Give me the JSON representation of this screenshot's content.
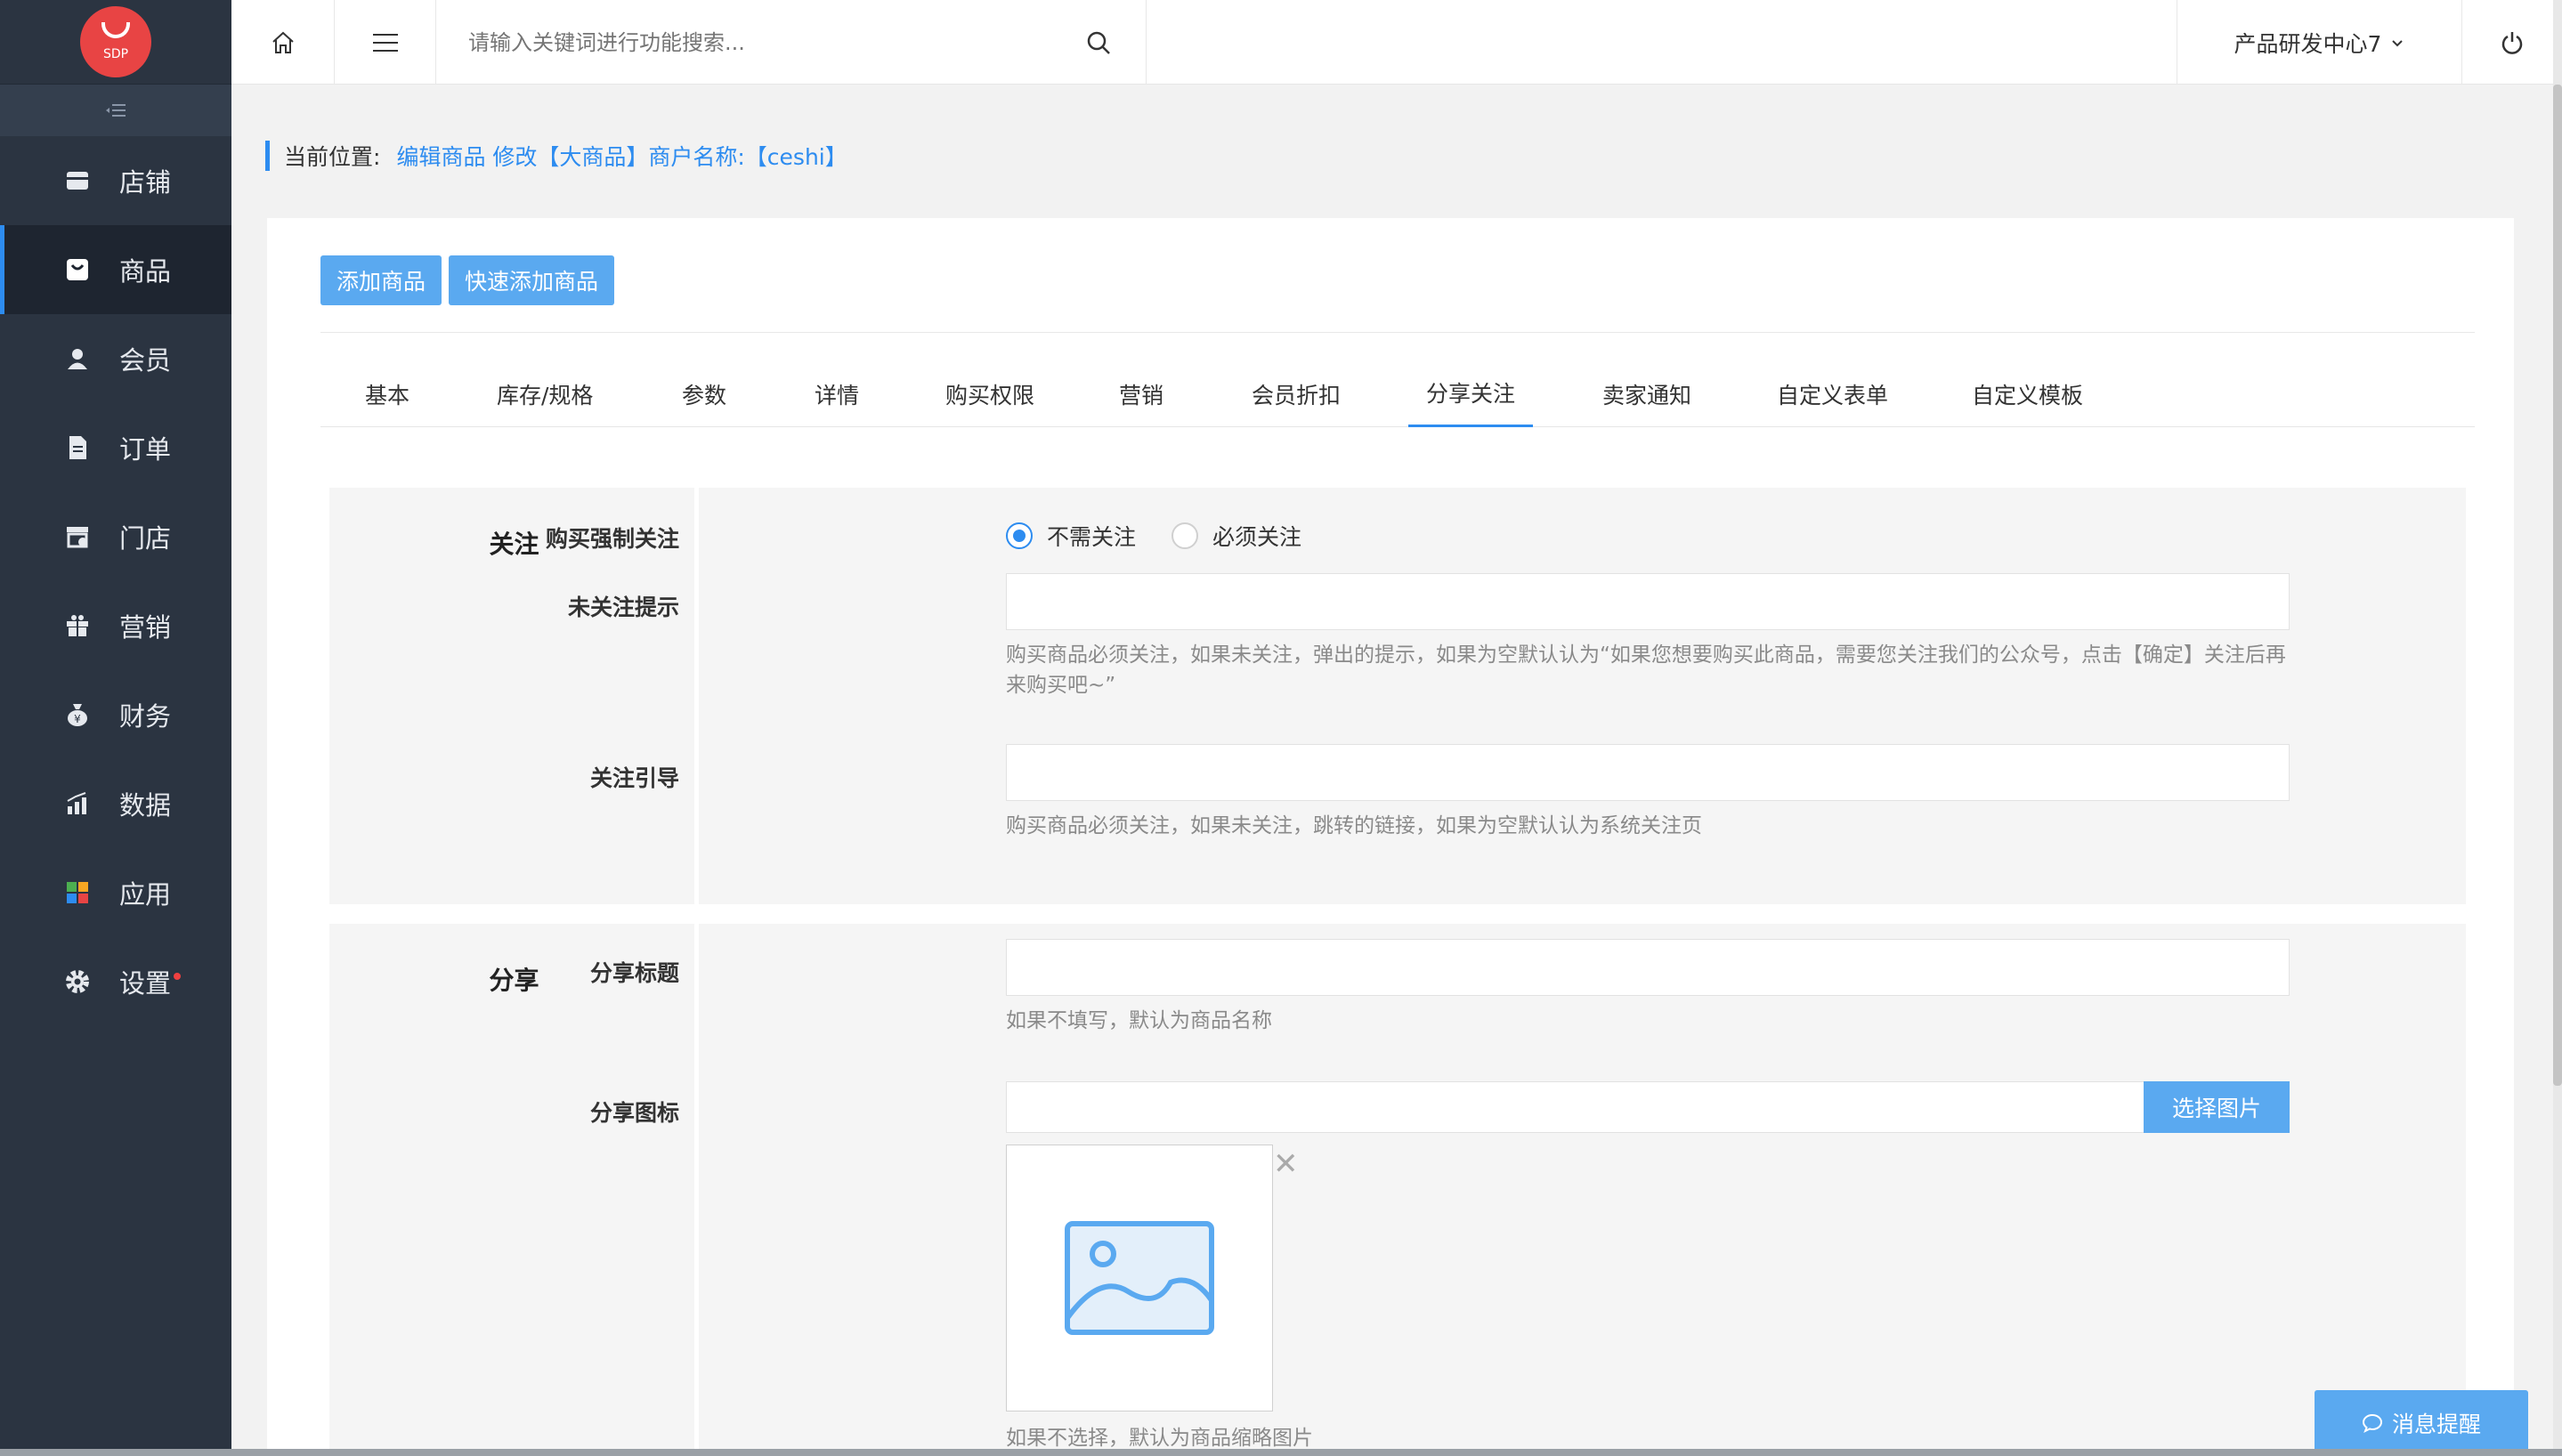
{
  "logo": {
    "text": "SDP"
  },
  "sidebar": {
    "items": [
      {
        "label": "店铺",
        "icon": "store-icon"
      },
      {
        "label": "商品",
        "icon": "bag-icon",
        "active": true
      },
      {
        "label": "会员",
        "icon": "user-icon"
      },
      {
        "label": "订单",
        "icon": "document-icon"
      },
      {
        "label": "门店",
        "icon": "shop-icon"
      },
      {
        "label": "营销",
        "icon": "gift-icon"
      },
      {
        "label": "财务",
        "icon": "money-bag-icon"
      },
      {
        "label": "数据",
        "icon": "chart-icon"
      },
      {
        "label": "应用",
        "icon": "apps-icon"
      },
      {
        "label": "设置",
        "icon": "gear-icon",
        "badge_dot": true
      }
    ]
  },
  "topbar": {
    "search_placeholder": "请输入关键词进行功能搜索...",
    "org_name": "产品研发中心7"
  },
  "breadcrumb": {
    "label": "当前位置:",
    "path": "编辑商品 修改【大商品】商户名称:【ceshi】"
  },
  "actions": {
    "add_goods": "添加商品",
    "quick_add_goods": "快速添加商品"
  },
  "tabs": [
    "基本",
    "库存/规格",
    "参数",
    "详情",
    "购买权限",
    "营销",
    "会员折扣",
    "分享关注",
    "卖家通知",
    "自定义表单",
    "自定义模板"
  ],
  "active_tab": "分享关注",
  "follow_section": {
    "title": "关注",
    "force_follow_label": "购买强制关注",
    "options": [
      "不需关注",
      "必须关注"
    ],
    "selected_option": "不需关注",
    "unfollowed_tip_label": "未关注提示",
    "unfollowed_tip_value": "",
    "unfollowed_tip_help": "购买商品必须关注，如果未关注，弹出的提示，如果为空默认认为“如果您想要购买此商品，需要您关注我们的公众号，点击【确定】关注后再来购买吧~”",
    "follow_guide_label": "关注引导",
    "follow_guide_value": "",
    "follow_guide_help": "购买商品必须关注，如果未关注，跳转的链接，如果为空默认认为系统关注页"
  },
  "share_section": {
    "title": "分享",
    "share_title_label": "分享标题",
    "share_title_value": "",
    "share_title_help": "如果不填写，默认为商品名称",
    "share_icon_label": "分享图标",
    "share_icon_value": "",
    "select_image": "选择图片",
    "share_icon_help": "如果不选择，默认为商品缩略图片"
  },
  "message_button": "消息提醒",
  "colors": {
    "primary": "#2d8cf0",
    "button": "#5aa9f0",
    "sidebar": "#2b3441"
  }
}
